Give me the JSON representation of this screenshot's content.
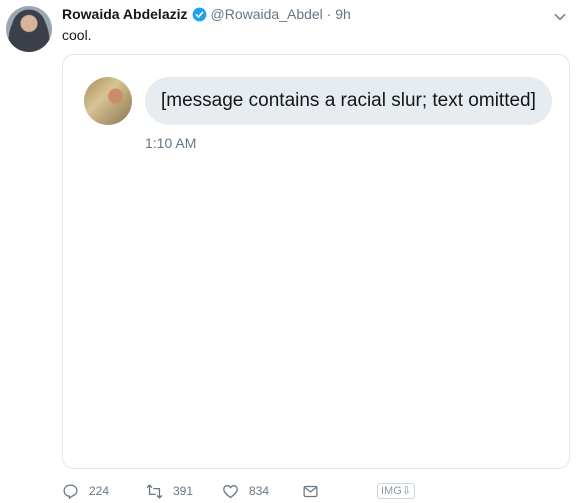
{
  "tweet": {
    "name": "Rowaida Abdelaziz",
    "handle_time": "@Rowaida_Abdel · 9h",
    "text": "cool."
  },
  "dm": {
    "message": "[message contains a racial slur; text omitted]",
    "time": "1:10 AM"
  },
  "actions": {
    "replies": "224",
    "retweets": "391",
    "likes": "834",
    "badge": "IMG⇩"
  },
  "icons": [
    "avatar",
    "verified-icon",
    "chevron-down-icon",
    "reply-icon",
    "retweet-icon",
    "like-icon",
    "dm-icon"
  ],
  "colors": {
    "brand": "#1da1f2",
    "secondary_text": "#657786",
    "bubble": "#e6ecf0",
    "border": "#e1e8ed"
  }
}
